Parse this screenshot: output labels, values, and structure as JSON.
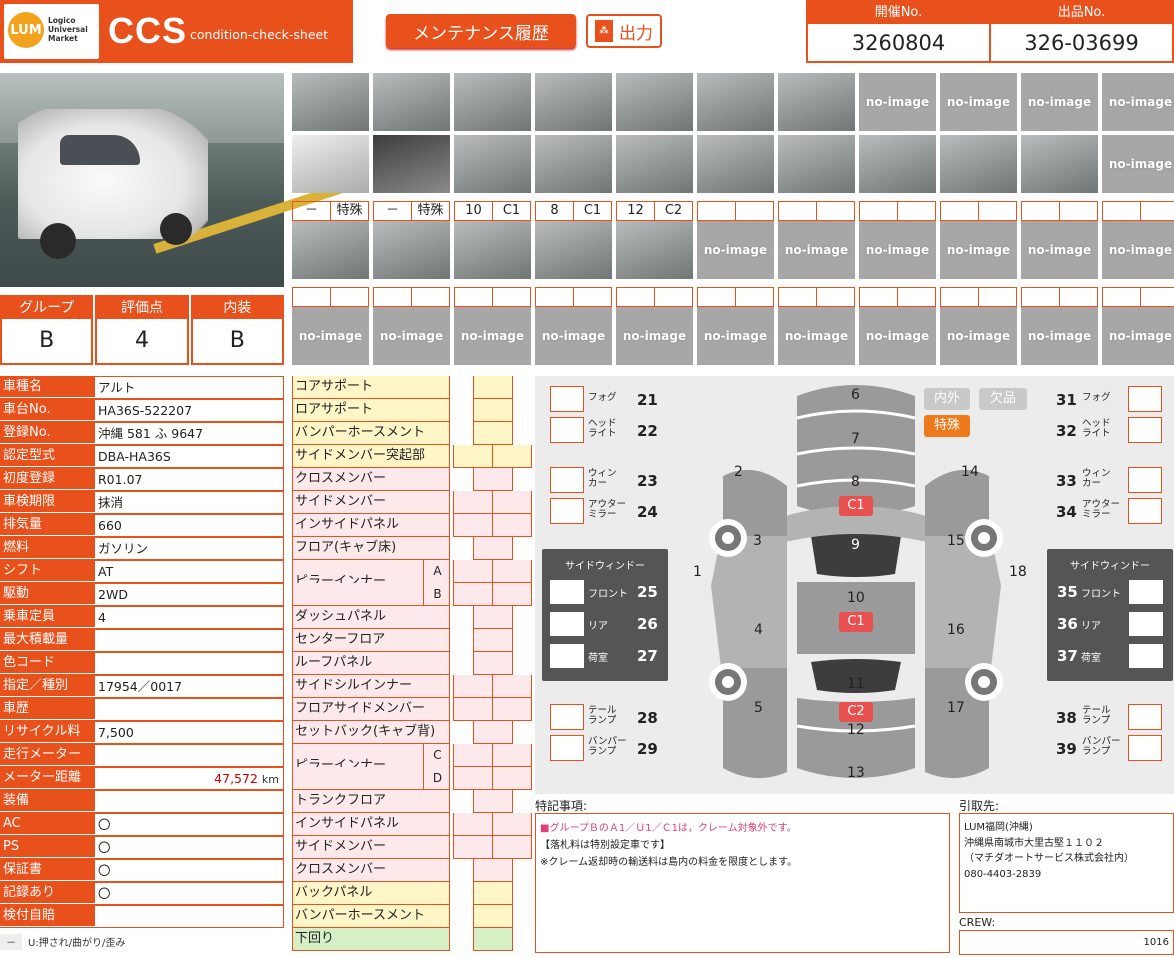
{
  "brand": {
    "logo_mark": "LUM",
    "logo_text": [
      "Logico",
      "Universal",
      "Market"
    ],
    "title": "CCS",
    "subtitle": "condition-check-sheet"
  },
  "buttons": {
    "maintenance": "メンテナンス履歴",
    "output": "出力",
    "pdf_icon": "pdf-icon"
  },
  "header": {
    "kaisai_label": "開催No.",
    "kaisai_value": "3260804",
    "shuppin_label": "出品No.",
    "shuppin_value": "326-03699"
  },
  "grade": {
    "group_label": "グループ",
    "group_value": "B",
    "score_label": "評価点",
    "score_value": "4",
    "interior_label": "内装",
    "interior_value": "B"
  },
  "thumbnails": {
    "row1": [
      "photo",
      "photo",
      "photo",
      "photo",
      "photo",
      "photo",
      "photo",
      "no-image",
      "no-image",
      "no-image",
      "no-image"
    ],
    "row2": [
      "photo",
      "photo",
      "photo",
      "photo",
      "photo",
      "photo",
      "photo",
      "photo",
      "photo",
      "photo",
      "no-image"
    ],
    "row3_labels": [
      [
        "－",
        "特殊"
      ],
      [
        "－",
        "特殊"
      ],
      [
        "10",
        "C1"
      ],
      [
        "8",
        "C1"
      ],
      [
        "12",
        "C2"
      ],
      [
        "",
        ""
      ],
      [
        "",
        ""
      ],
      [
        "",
        ""
      ],
      [
        "",
        ""
      ],
      [
        "",
        ""
      ],
      [
        "",
        ""
      ]
    ],
    "row3": [
      "photo",
      "photo",
      "photo",
      "photo",
      "photo",
      "no-image",
      "no-image",
      "no-image",
      "no-image",
      "no-image",
      "no-image"
    ],
    "row4_labels": [
      [
        "",
        ""
      ],
      [
        "",
        ""
      ],
      [
        "",
        ""
      ],
      [
        "",
        ""
      ],
      [
        "",
        ""
      ],
      [
        "",
        ""
      ],
      [
        "",
        ""
      ],
      [
        "",
        ""
      ],
      [
        "",
        ""
      ],
      [
        "",
        ""
      ],
      [
        "",
        ""
      ]
    ],
    "row4": [
      "no-image",
      "no-image",
      "no-image",
      "no-image",
      "no-image",
      "no-image",
      "no-image",
      "no-image",
      "no-image",
      "no-image",
      "no-image"
    ],
    "no_image_text": "no-image"
  },
  "spec": [
    {
      "k": "車種名",
      "v": "アルト"
    },
    {
      "k": "車台No.",
      "v": "HA36S-522207"
    },
    {
      "k": "登録No.",
      "v": "沖縄 581 ふ 9647"
    },
    {
      "k": "認定型式",
      "v": "DBA-HA36S"
    },
    {
      "k": "初度登録",
      "v": "R01.07"
    },
    {
      "k": "車検期限",
      "v": "抹消"
    },
    {
      "k": "排気量",
      "v": "660"
    },
    {
      "k": "燃料",
      "v": "ガソリン"
    },
    {
      "k": "シフト",
      "v": "AT"
    },
    {
      "k": "駆動",
      "v": "2WD"
    },
    {
      "k": "乗車定員",
      "v": "4"
    },
    {
      "k": "最大積載量",
      "v": ""
    },
    {
      "k": "色コード",
      "v": ""
    },
    {
      "k": "指定／種別",
      "v": "17954／0017"
    },
    {
      "k": "車歴",
      "v": ""
    },
    {
      "k": "リサイクル料",
      "v": "7,500"
    },
    {
      "k": "走行メーター",
      "v": ""
    },
    {
      "k": "メーター距離",
      "v": ""
    },
    {
      "k": "装備",
      "v": ""
    },
    {
      "k": "AC",
      "v": "〇"
    },
    {
      "k": "PS",
      "v": "〇"
    },
    {
      "k": "保証書",
      "v": "〇"
    },
    {
      "k": "記録あり",
      "v": "〇"
    },
    {
      "k": "検付自賠",
      "v": ""
    }
  ],
  "meter": {
    "value": "47,572",
    "unit": "km"
  },
  "legend": {
    "dash": "－",
    "text": "U:押され/曲がり/歪み"
  },
  "parts": [
    {
      "name": "コアサポート",
      "color": "y",
      "boxes": "single"
    },
    {
      "name": "ロアサポート",
      "color": "y",
      "boxes": "single"
    },
    {
      "name": "バンパーホースメント",
      "color": "y",
      "boxes": "single"
    },
    {
      "name": "サイドメンバー突起部",
      "color": "y",
      "boxes": "double-wide"
    },
    {
      "name": "クロスメンバー",
      "color": "p",
      "boxes": "single"
    },
    {
      "name": "サイドメンバー",
      "color": "p",
      "boxes": "double"
    },
    {
      "name": "インサイドパネル",
      "color": "p",
      "boxes": "double"
    },
    {
      "name": "フロア(キャブ床)",
      "color": "p",
      "boxes": "single"
    },
    {
      "name": "ピラーインナー",
      "color": "p",
      "boxes": "double",
      "sub": "A"
    },
    {
      "name": "",
      "color": "p",
      "boxes": "double",
      "sub": "B"
    },
    {
      "name": "ダッシュパネル",
      "color": "p",
      "boxes": "single"
    },
    {
      "name": "センターフロア",
      "color": "p",
      "boxes": "single"
    },
    {
      "name": "ルーフパネル",
      "color": "p",
      "boxes": "single"
    },
    {
      "name": "サイドシルインナー",
      "color": "p",
      "boxes": "double"
    },
    {
      "name": "フロアサイドメンバー",
      "color": "p",
      "boxes": "double"
    },
    {
      "name": "セットバック(キャブ背)",
      "color": "p",
      "boxes": "single"
    },
    {
      "name": "ピラーインナー",
      "color": "p",
      "boxes": "double",
      "sub": "C"
    },
    {
      "name": "",
      "color": "p",
      "boxes": "double",
      "sub": "D"
    },
    {
      "name": "トランクフロア",
      "color": "p",
      "boxes": "single"
    },
    {
      "name": "インサイドパネル",
      "color": "p",
      "boxes": "double"
    },
    {
      "name": "サイドメンバー",
      "color": "p",
      "boxes": "double"
    },
    {
      "name": "クロスメンバー",
      "color": "p",
      "boxes": "single"
    },
    {
      "name": "バックパネル",
      "color": "y",
      "boxes": "single"
    },
    {
      "name": "バンパーホースメント",
      "color": "y",
      "boxes": "single"
    },
    {
      "name": "下回り",
      "color": "g",
      "boxes": "single"
    }
  ],
  "diagram": {
    "left": [
      {
        "label": "フォグ",
        "num": "21"
      },
      {
        "label": "ヘッド\nライト",
        "num": "22"
      },
      {
        "label": "ウィン\nカー",
        "num": "23"
      },
      {
        "label": "アウター\nミラー",
        "num": "24"
      },
      {
        "label": "テール\nランプ",
        "num": "28"
      },
      {
        "label": "バンパー\nランプ",
        "num": "29"
      }
    ],
    "right": [
      {
        "label": "フォグ",
        "num": "31"
      },
      {
        "label": "ヘッド\nライト",
        "num": "32"
      },
      {
        "label": "ウィン\nカー",
        "num": "33"
      },
      {
        "label": "アウター\nミラー",
        "num": "34"
      },
      {
        "label": "テール\nランプ",
        "num": "38"
      },
      {
        "label": "バンパー\nランプ",
        "num": "39"
      }
    ],
    "side_window_title": "サイドウィンドー",
    "side_left": [
      {
        "label": "フロント",
        "num": "25"
      },
      {
        "label": "リア",
        "num": "26"
      },
      {
        "label": "荷室",
        "num": "27"
      }
    ],
    "side_right": [
      {
        "label": "フロント",
        "num": "35"
      },
      {
        "label": "リア",
        "num": "36"
      },
      {
        "label": "荷室",
        "num": "37"
      }
    ],
    "car_numbers": [
      "1",
      "2",
      "3",
      "4",
      "5",
      "6",
      "7",
      "8",
      "9",
      "10",
      "11",
      "12",
      "13",
      "14",
      "15",
      "16",
      "17",
      "18"
    ],
    "tags": {
      "naigai": "内外",
      "ketsuhin": "欠品",
      "tokushu": "特殊"
    },
    "damage": [
      {
        "pos": "8",
        "code": "C1"
      },
      {
        "pos": "10",
        "code": "C1"
      },
      {
        "pos": "12",
        "code": "C2"
      }
    ],
    "colors": {
      "car": "#9a9a9a",
      "car_light": "#b3b3b3",
      "glass": "#3d3d3d",
      "accent": "#e8501c",
      "damage": "#e85050"
    }
  },
  "notes": {
    "label": "特記事項:",
    "lines": [
      "■グループＢのＡ1／Ｕ1／Ｃ1は，クレーム対象外です。",
      "【落札料は特別設定車です】",
      "※クレーム返却時の輸送料は島内の料金を限度とします。"
    ]
  },
  "destination": {
    "label": "引取先:",
    "lines": [
      "LUM福岡(沖縄)",
      "沖縄県南城市大里古堅１１０２",
      "（マチダオートサービス株式会社内）",
      "080-4403-2839"
    ]
  },
  "crew": {
    "label": "CREW:",
    "value": "1016"
  }
}
